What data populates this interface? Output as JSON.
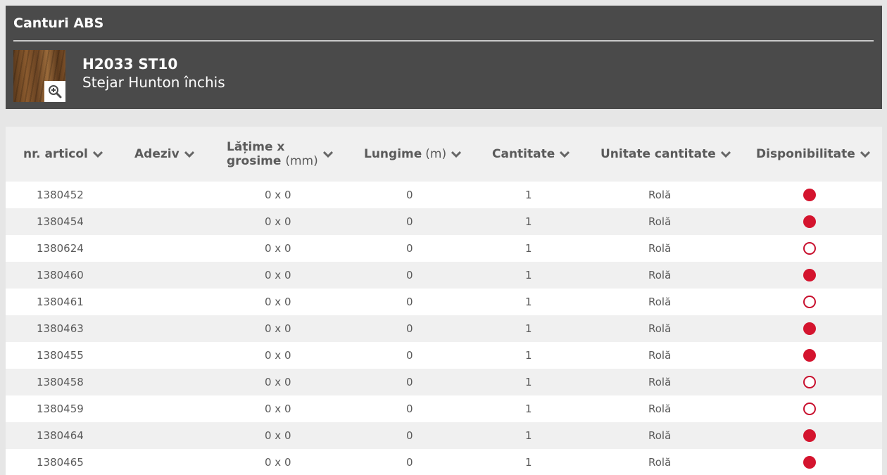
{
  "header": {
    "title": "Canturi ABS",
    "product_code": "H2033 ST10",
    "product_name": "Stejar Hunton închis"
  },
  "table": {
    "columns": [
      {
        "label": "nr. articol",
        "unit": ""
      },
      {
        "label": "Adeziv",
        "unit": ""
      },
      {
        "label_line1": "Lățime x",
        "label_line2": "grosime",
        "unit": "(mm)"
      },
      {
        "label": "Lungime",
        "unit": "(m)"
      },
      {
        "label": "Cantitate",
        "unit": ""
      },
      {
        "label": "Unitate cantitate",
        "unit": ""
      },
      {
        "label": "Disponibilitate",
        "unit": ""
      }
    ],
    "rows": [
      {
        "article": "1380452",
        "adhesive": "",
        "dimensions": "0 x 0",
        "length": "0",
        "quantity": "1",
        "unit": "Rolă",
        "available": true
      },
      {
        "article": "1380454",
        "adhesive": "",
        "dimensions": "0 x 0",
        "length": "0",
        "quantity": "1",
        "unit": "Rolă",
        "available": true
      },
      {
        "article": "1380624",
        "adhesive": "",
        "dimensions": "0 x 0",
        "length": "0",
        "quantity": "1",
        "unit": "Rolă",
        "available": false
      },
      {
        "article": "1380460",
        "adhesive": "",
        "dimensions": "0 x 0",
        "length": "0",
        "quantity": "1",
        "unit": "Rolă",
        "available": true
      },
      {
        "article": "1380461",
        "adhesive": "",
        "dimensions": "0 x 0",
        "length": "0",
        "quantity": "1",
        "unit": "Rolă",
        "available": false
      },
      {
        "article": "1380463",
        "adhesive": "",
        "dimensions": "0 x 0",
        "length": "0",
        "quantity": "1",
        "unit": "Rolă",
        "available": true
      },
      {
        "article": "1380455",
        "adhesive": "",
        "dimensions": "0 x 0",
        "length": "0",
        "quantity": "1",
        "unit": "Rolă",
        "available": true
      },
      {
        "article": "1380458",
        "adhesive": "",
        "dimensions": "0 x 0",
        "length": "0",
        "quantity": "1",
        "unit": "Rolă",
        "available": false
      },
      {
        "article": "1380459",
        "adhesive": "",
        "dimensions": "0 x 0",
        "length": "0",
        "quantity": "1",
        "unit": "Rolă",
        "available": false
      },
      {
        "article": "1380464",
        "adhesive": "",
        "dimensions": "0 x 0",
        "length": "0",
        "quantity": "1",
        "unit": "Rolă",
        "available": true
      },
      {
        "article": "1380465",
        "adhesive": "",
        "dimensions": "0 x 0",
        "length": "0",
        "quantity": "1",
        "unit": "Rolă",
        "available": true
      }
    ]
  },
  "icons": {
    "zoom": "zoom-in-icon",
    "sort": "chevron-down-icon",
    "availability_filled": "availability-filled-icon",
    "availability_empty": "availability-empty-icon"
  },
  "colors": {
    "header_bg": "#4a4a4a",
    "available": "#d4142e",
    "stripe": "#f0f0f0"
  }
}
